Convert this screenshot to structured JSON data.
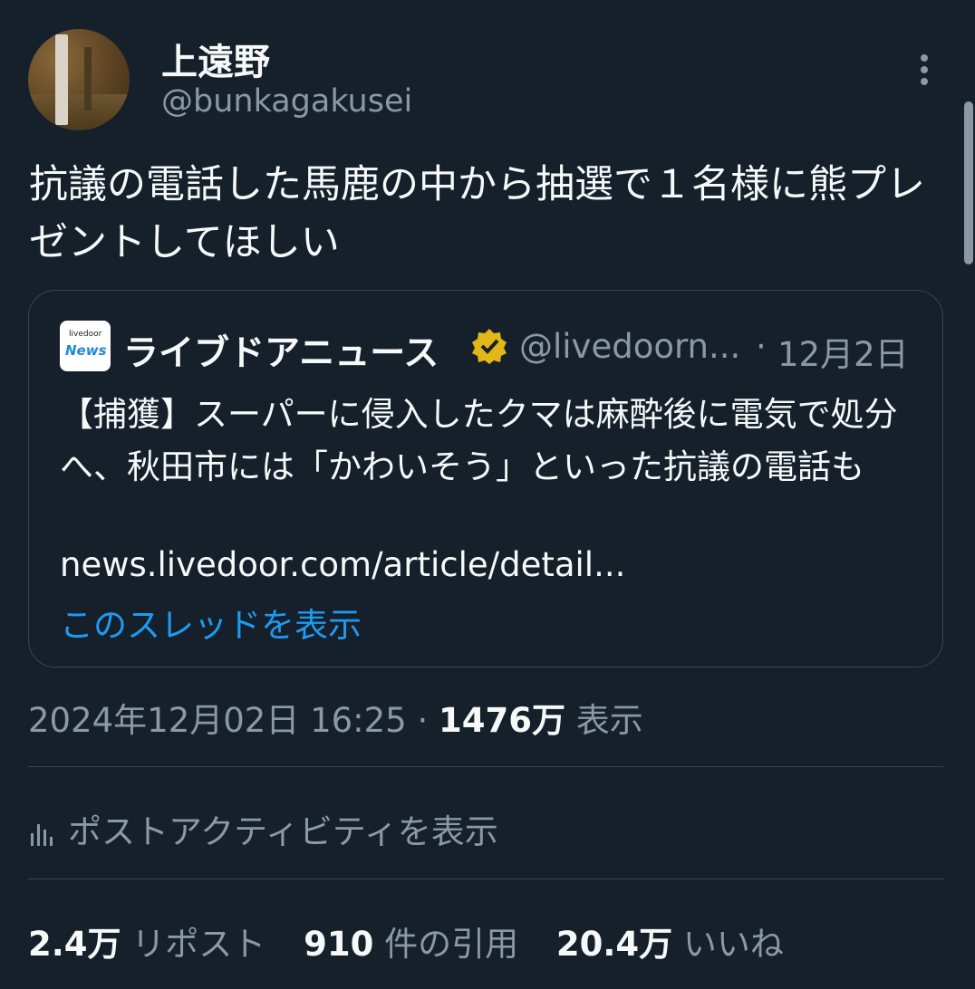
{
  "author": {
    "display_name": "上遠野",
    "handle": "@bunkagakusei"
  },
  "tweet": {
    "text": "抗議の電話した馬鹿の中から抽選で１名様に熊プレゼントしてほしい"
  },
  "quote": {
    "logo_line1": "livedoor",
    "logo_line2": "News",
    "name": "ライブドアニュース",
    "handle": "@livedoorn...",
    "separator": "·",
    "date": "12月2日",
    "text": "【捕獲】スーパーに侵入したクマは麻酔後に電気で処分へ、秋田市には「かわいそう」といった抗議の電話も",
    "link": "news.livedoor.com/article/detail...",
    "show_thread": "このスレッドを表示"
  },
  "meta": {
    "timestamp": "2024年12月02日 16:25",
    "separator": " · ",
    "views_count": "1476万",
    "views_label": " 表示"
  },
  "activity": {
    "label": "ポストアクティビティを表示",
    "icon": "bar-chart-icon"
  },
  "stats": {
    "reposts_count": "2.4万",
    "reposts_label": " リポスト",
    "quotes_count": "910",
    "quotes_label": " 件の引用",
    "likes_count": "20.4万",
    "likes_label": " いいね"
  },
  "colors": {
    "background": "#15202b",
    "text": "#f7f9f9",
    "secondary": "#8b98a5",
    "link": "#1d9bf0",
    "verified": "#e2b719"
  }
}
